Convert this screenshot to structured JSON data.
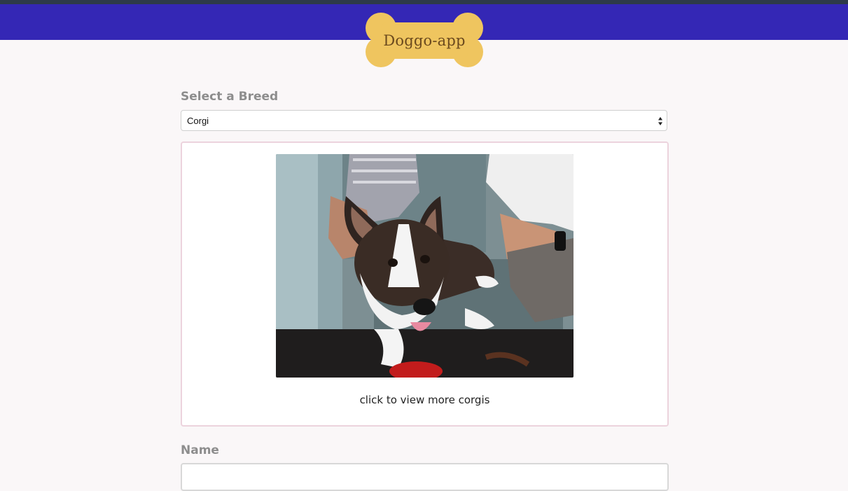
{
  "header": {
    "logo_text": "Doggo-app",
    "colors": {
      "bar": "#3427b5",
      "bone": "#efc55f",
      "bone_text": "#6b4a1e"
    }
  },
  "breed_section": {
    "label": "Select a Breed",
    "selected": "Corgi"
  },
  "photo_card": {
    "image_alt": "corgi photo",
    "caption": "click to view more corgis"
  },
  "name_section": {
    "label": "Name",
    "value": ""
  }
}
